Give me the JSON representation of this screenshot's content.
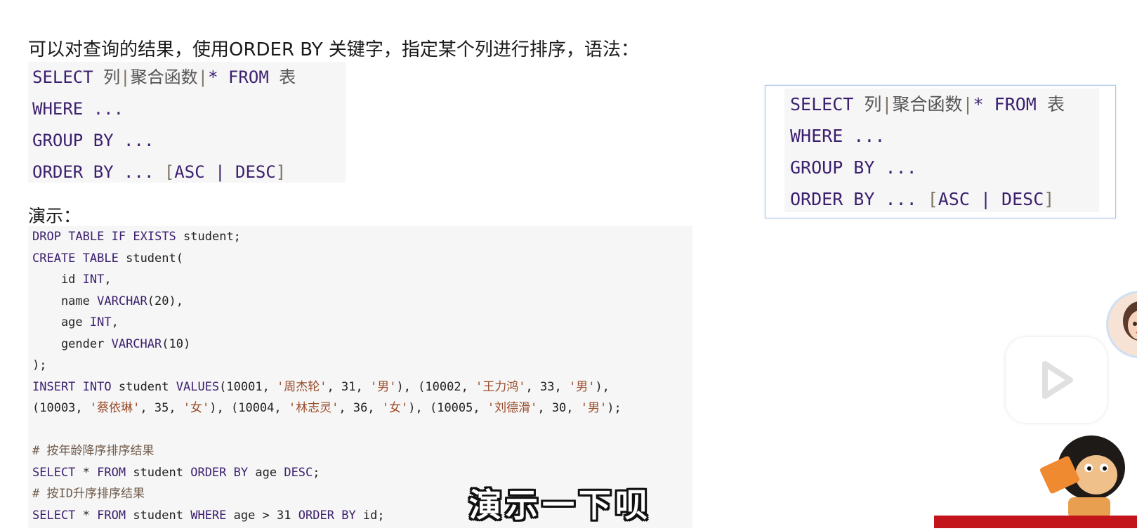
{
  "intro_text": "可以对查询的结果，使用ORDER BY 关键字，指定某个列进行排序，语法：",
  "syntax": {
    "select_kw": "SELECT",
    "col": "列",
    "pipe1": "|",
    "agg": "聚合函数",
    "pipe2": "|",
    "star": "*",
    "from_kw": "FROM",
    "table": "表",
    "where": "WHERE ...",
    "group": "GROUP BY ...",
    "order": "ORDER BY ...",
    "lbr": "[",
    "asc_desc": "ASC | DESC",
    "rbr": "]"
  },
  "demo_label": "演示：",
  "code_lines": [
    "DROP TABLE IF EXISTS student;",
    "CREATE TABLE student(",
    "    id INT,",
    "    name VARCHAR(20),",
    "    age INT,",
    "    gender VARCHAR(10)",
    ");",
    "INSERT INTO student VALUES(10001, '周杰轮', 31, '男'), (10002, '王力鸿', 33, '男'),",
    "(10003, '蔡依琳', 35, '女'), (10004, '林志灵', 36, '女'), (10005, '刘德滑', 30, '男');",
    "",
    "# 按年龄降序排序结果",
    "SELECT * FROM student ORDER BY age DESC;",
    "# 按ID升序排序结果",
    "SELECT * FROM student WHERE age > 31 ORDER BY id;"
  ],
  "subtitle": "演示一下呗",
  "colors": {
    "keyword": "#3b1f6e",
    "string": "#9a4d2b",
    "code_bg": "#f6f6f6",
    "card_border": "#a7c3e6",
    "banner": "#c3141b"
  },
  "icons": {
    "play": "play-icon",
    "avatar": "presenter-avatar",
    "mascot": "monkey-mascot"
  }
}
